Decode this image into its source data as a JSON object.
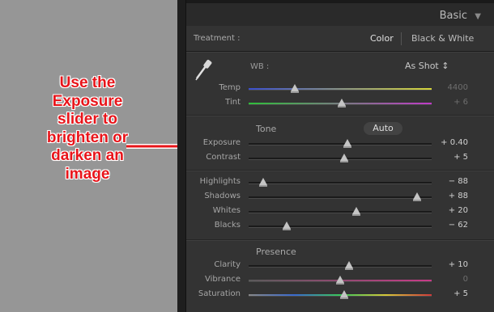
{
  "annotation": {
    "text_lines": [
      "Use the",
      "Exposure",
      "slider to",
      "brighten or",
      "darken an",
      "image"
    ],
    "color": "#e8141a"
  },
  "panel": {
    "title": "Basic",
    "collapse_icon": "triangle-down-icon",
    "treatment": {
      "label": "Treatment :",
      "color_option": "Color",
      "bw_option": "Black & White"
    },
    "wb": {
      "label": "WB :",
      "value": "As Shot ↕",
      "sliders": [
        {
          "label": "Temp",
          "value": "4400",
          "level": 0.25,
          "dim": true,
          "track": "temp"
        },
        {
          "label": "Tint",
          "value": "+ 6",
          "level": 0.51,
          "dim": true,
          "track": "tint"
        }
      ]
    },
    "tone": {
      "title": "Tone",
      "auto_label": "Auto",
      "sliders": [
        {
          "label": "Exposure",
          "value": "+ 0.40",
          "level": 0.54,
          "dim": false
        },
        {
          "label": "Contrast",
          "value": "+ 5",
          "level": 0.52,
          "dim": false
        }
      ],
      "sliders2": [
        {
          "label": "Highlights",
          "value": "− 88",
          "level": 0.08,
          "dim": false
        },
        {
          "label": "Shadows",
          "value": "+ 88",
          "level": 0.92,
          "dim": false
        },
        {
          "label": "Whites",
          "value": "+ 20",
          "level": 0.59,
          "dim": false
        },
        {
          "label": "Blacks",
          "value": "− 62",
          "level": 0.21,
          "dim": false
        }
      ]
    },
    "presence": {
      "title": "Presence",
      "sliders": [
        {
          "label": "Clarity",
          "value": "+ 10",
          "level": 0.55,
          "dim": false
        },
        {
          "label": "Vibrance",
          "value": "0",
          "level": 0.5,
          "dim": true,
          "track": "vibrance"
        },
        {
          "label": "Saturation",
          "value": "+ 5",
          "level": 0.52,
          "dim": false,
          "track": "saturation"
        }
      ]
    }
  }
}
